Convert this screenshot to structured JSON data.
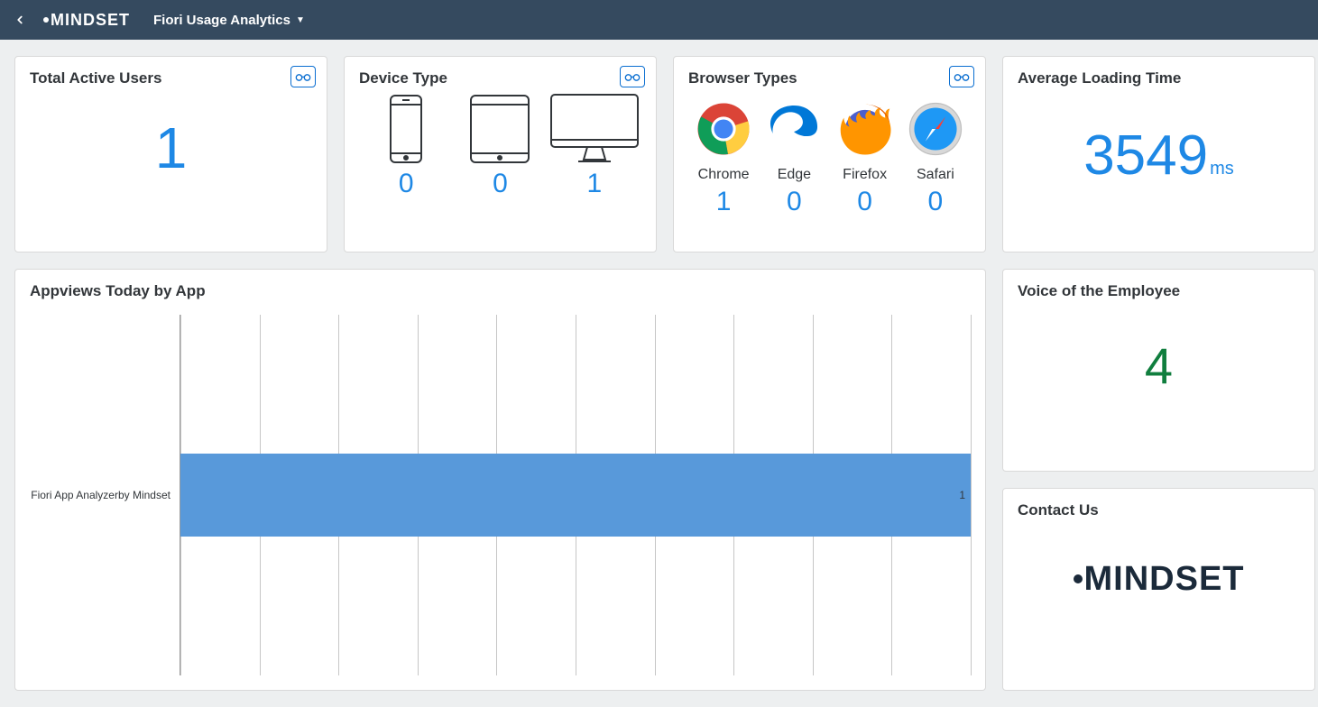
{
  "header": {
    "logo": "MINDSET",
    "title": "Fiori Usage Analytics"
  },
  "cards": {
    "active_users": {
      "title": "Total Active Users",
      "value": "1"
    },
    "device_type": {
      "title": "Device Type",
      "items": [
        {
          "label": "",
          "value": "0",
          "icon": "phone"
        },
        {
          "label": "",
          "value": "0",
          "icon": "tablet"
        },
        {
          "label": "",
          "value": "1",
          "icon": "desktop"
        }
      ]
    },
    "browser_types": {
      "title": "Browser Types",
      "items": [
        {
          "label": "Chrome",
          "value": "1"
        },
        {
          "label": "Edge",
          "value": "0"
        },
        {
          "label": "Firefox",
          "value": "0"
        },
        {
          "label": "Safari",
          "value": "0"
        }
      ]
    },
    "avg_load": {
      "title": "Average Loading Time",
      "value": "3549",
      "unit": "ms"
    },
    "appviews": {
      "title": "Appviews Today by App"
    },
    "voe": {
      "title": "Voice of the Employee",
      "value": "4"
    },
    "contact": {
      "title": "Contact Us",
      "logo": "MINDSET"
    }
  },
  "chart_data": {
    "type": "bar",
    "orientation": "horizontal",
    "categories": [
      "Fiori App Analyzerby Mindset"
    ],
    "values": [
      1
    ],
    "xlim": [
      0,
      1
    ],
    "grid_divisions": 10,
    "title": "Appviews Today by App",
    "xlabel": "",
    "ylabel": ""
  }
}
